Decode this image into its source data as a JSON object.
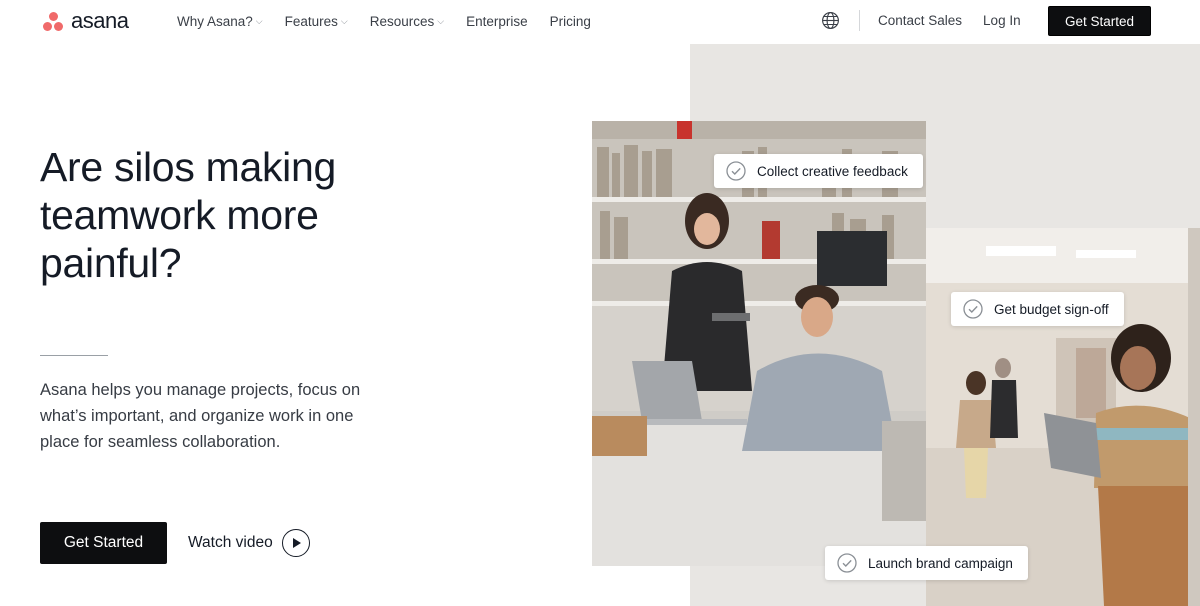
{
  "brand": {
    "name": "asana",
    "color": "#f06a6a"
  },
  "nav": {
    "links": [
      {
        "label": "Why Asana?",
        "has_caret": true
      },
      {
        "label": "Features",
        "has_caret": true
      },
      {
        "label": "Resources",
        "has_caret": true
      },
      {
        "label": "Enterprise",
        "has_caret": false
      },
      {
        "label": "Pricing",
        "has_caret": false
      }
    ],
    "caret_glyph": "⌵",
    "globe_icon": "globe-icon",
    "contact_sales": "Contact Sales",
    "log_in": "Log In",
    "get_started": "Get Started"
  },
  "hero": {
    "title_lines": [
      "Are silos making",
      "teamwork more",
      "painful?"
    ],
    "body": "Asana helps you manage projects, focus on what’s important, and organize work in one place for seamless collaboration.",
    "primary_cta": "Get Started",
    "secondary_cta": "Watch video",
    "secondary_icon": "play-circle-icon"
  },
  "collage": {
    "tasks": [
      {
        "label": "Collect creative feedback",
        "icon": "check-circle-icon"
      },
      {
        "label": "Get budget sign-off",
        "icon": "check-circle-icon"
      },
      {
        "label": "Launch brand campaign",
        "icon": "check-circle-icon"
      }
    ],
    "backdrop_color": "#e8e6e3"
  },
  "colors": {
    "cta_bg": "#0d0e10",
    "text": "#151b26"
  }
}
